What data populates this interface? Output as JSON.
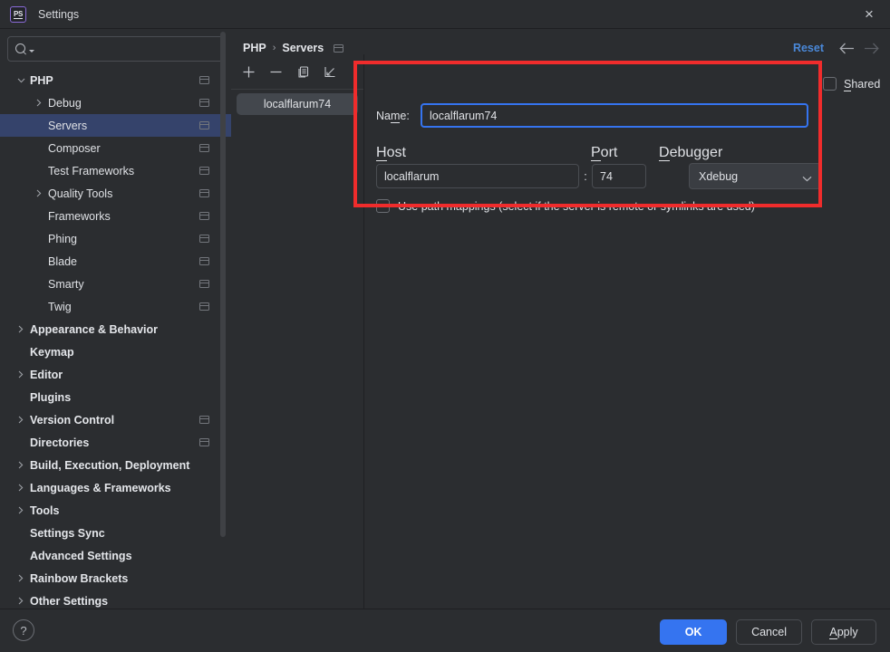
{
  "window": {
    "title": "Settings",
    "app_icon": "phpstorm-icon",
    "close_label": "×"
  },
  "sidebar": {
    "search": {
      "placeholder": "",
      "value": "",
      "icon": "search-icon"
    },
    "items": [
      {
        "label": "PHP",
        "depth": 0,
        "bold": true,
        "expandable": true,
        "expanded": true,
        "selected": false,
        "copyable": true
      },
      {
        "label": "Debug",
        "depth": 1,
        "bold": false,
        "expandable": true,
        "expanded": false,
        "selected": false,
        "copyable": true
      },
      {
        "label": "Servers",
        "depth": 1,
        "bold": false,
        "expandable": false,
        "expanded": false,
        "selected": true,
        "copyable": true
      },
      {
        "label": "Composer",
        "depth": 1,
        "bold": false,
        "expandable": false,
        "expanded": false,
        "selected": false,
        "copyable": true
      },
      {
        "label": "Test Frameworks",
        "depth": 1,
        "bold": false,
        "expandable": false,
        "expanded": false,
        "selected": false,
        "copyable": true
      },
      {
        "label": "Quality Tools",
        "depth": 1,
        "bold": false,
        "expandable": true,
        "expanded": false,
        "selected": false,
        "copyable": true
      },
      {
        "label": "Frameworks",
        "depth": 1,
        "bold": false,
        "expandable": false,
        "expanded": false,
        "selected": false,
        "copyable": true
      },
      {
        "label": "Phing",
        "depth": 1,
        "bold": false,
        "expandable": false,
        "expanded": false,
        "selected": false,
        "copyable": true
      },
      {
        "label": "Blade",
        "depth": 1,
        "bold": false,
        "expandable": false,
        "expanded": false,
        "selected": false,
        "copyable": true
      },
      {
        "label": "Smarty",
        "depth": 1,
        "bold": false,
        "expandable": false,
        "expanded": false,
        "selected": false,
        "copyable": true
      },
      {
        "label": "Twig",
        "depth": 1,
        "bold": false,
        "expandable": false,
        "expanded": false,
        "selected": false,
        "copyable": true
      },
      {
        "label": "Appearance & Behavior",
        "depth": 0,
        "bold": true,
        "expandable": true,
        "expanded": false,
        "selected": false,
        "copyable": false
      },
      {
        "label": "Keymap",
        "depth": 0,
        "bold": true,
        "expandable": false,
        "expanded": false,
        "selected": false,
        "copyable": false
      },
      {
        "label": "Editor",
        "depth": 0,
        "bold": true,
        "expandable": true,
        "expanded": false,
        "selected": false,
        "copyable": false
      },
      {
        "label": "Plugins",
        "depth": 0,
        "bold": true,
        "expandable": false,
        "expanded": false,
        "selected": false,
        "copyable": false
      },
      {
        "label": "Version Control",
        "depth": 0,
        "bold": true,
        "expandable": true,
        "expanded": false,
        "selected": false,
        "copyable": true
      },
      {
        "label": "Directories",
        "depth": 0,
        "bold": true,
        "expandable": false,
        "expanded": false,
        "selected": false,
        "copyable": true
      },
      {
        "label": "Build, Execution, Deployment",
        "depth": 0,
        "bold": true,
        "expandable": true,
        "expanded": false,
        "selected": false,
        "copyable": false
      },
      {
        "label": "Languages & Frameworks",
        "depth": 0,
        "bold": true,
        "expandable": true,
        "expanded": false,
        "selected": false,
        "copyable": false
      },
      {
        "label": "Tools",
        "depth": 0,
        "bold": true,
        "expandable": true,
        "expanded": false,
        "selected": false,
        "copyable": false
      },
      {
        "label": "Settings Sync",
        "depth": 0,
        "bold": true,
        "expandable": false,
        "expanded": false,
        "selected": false,
        "copyable": false
      },
      {
        "label": "Advanced Settings",
        "depth": 0,
        "bold": true,
        "expandable": false,
        "expanded": false,
        "selected": false,
        "copyable": false
      },
      {
        "label": "Rainbow Brackets",
        "depth": 0,
        "bold": true,
        "expandable": true,
        "expanded": false,
        "selected": false,
        "copyable": false
      },
      {
        "label": "Other Settings",
        "depth": 0,
        "bold": true,
        "expandable": true,
        "expanded": false,
        "selected": false,
        "copyable": false
      }
    ]
  },
  "main": {
    "breadcrumb": {
      "root": "PHP",
      "separator": "›",
      "leaf": "Servers"
    },
    "reset_label": "Reset",
    "nav": {
      "back_icon": "arrow-left-icon",
      "forward_icon": "arrow-right-icon"
    },
    "toolbar": [
      {
        "name": "add-server-button",
        "glyph": "+"
      },
      {
        "name": "remove-server-button",
        "glyph": "−"
      },
      {
        "name": "copy-server-button",
        "glyph": "copy-icon"
      },
      {
        "name": "import-server-button",
        "glyph": "import-icon"
      }
    ],
    "servers": [
      {
        "name": "localflarum74",
        "selected": true
      }
    ],
    "form": {
      "name": {
        "label": "Name:",
        "label_pre": "Na",
        "label_mn": "m",
        "label_post": "e:",
        "value": "localflarum74",
        "focused": true
      },
      "shared": {
        "label": "Shared",
        "label_mn": "S",
        "label_post": "hared",
        "checked": false
      },
      "host": {
        "label": "Host",
        "label_mn": "H",
        "label_post": "ost",
        "value": "localflarum"
      },
      "separator": ":",
      "port": {
        "label": "Port",
        "label_mn": "P",
        "label_post": "ort",
        "value": "74"
      },
      "debugger": {
        "label": "Debugger",
        "label_mn": "D",
        "label_post": "ebugger",
        "value": "Xdebug",
        "icon": "chevron-down-icon"
      },
      "path_mappings": {
        "label": "Use path mappings (select if the server is remote or symlinks are used)",
        "checked": false
      }
    }
  },
  "highlight": {
    "color": "#f02c2c"
  },
  "footer": {
    "help_label": "?",
    "ok_label": "OK",
    "cancel_label": "Cancel",
    "apply_label": "Apply",
    "apply_mn": "A",
    "apply_post": "pply"
  },
  "colors": {
    "background": "#2b2d30",
    "selection": "#35436b",
    "accent": "#3574f0",
    "link": "#4a88d8",
    "highlight": "#f02c2c"
  }
}
